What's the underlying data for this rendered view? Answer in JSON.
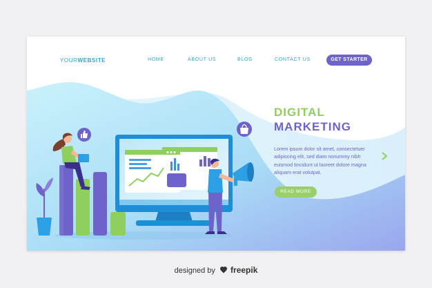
{
  "nav": {
    "brand_prefix": "YOUR",
    "brand_bold": "WEBSITE",
    "items": [
      "HOME",
      "ABOUT US",
      "BLOG",
      "CONTACT US"
    ],
    "cta_label": "GET STARTER"
  },
  "hero": {
    "title_line1": "DIGITAL",
    "title_line2": "MARKETING",
    "body": "Lorem ipsum dolor sit amet, consectetuer adipiscing elit, sed diam nonummy nibh euismod tincidunt ut laoreet dolore magna aliquam erat volutpat.",
    "button_label": "READ MORE"
  },
  "footer": {
    "designed_by": "designed by",
    "brand": "freepik"
  },
  "colors": {
    "primary_purple": "#6e63c9",
    "accent_green": "#8fcf5d",
    "nav_blue": "#37a3d2",
    "hero_gradient_start": "#c9f0fb",
    "hero_gradient_end": "#9fa8ee"
  },
  "icons": [
    "like-icon",
    "shopping-bag-icon",
    "megaphone-icon",
    "chevron-right-icon",
    "freepik-logo-icon"
  ]
}
